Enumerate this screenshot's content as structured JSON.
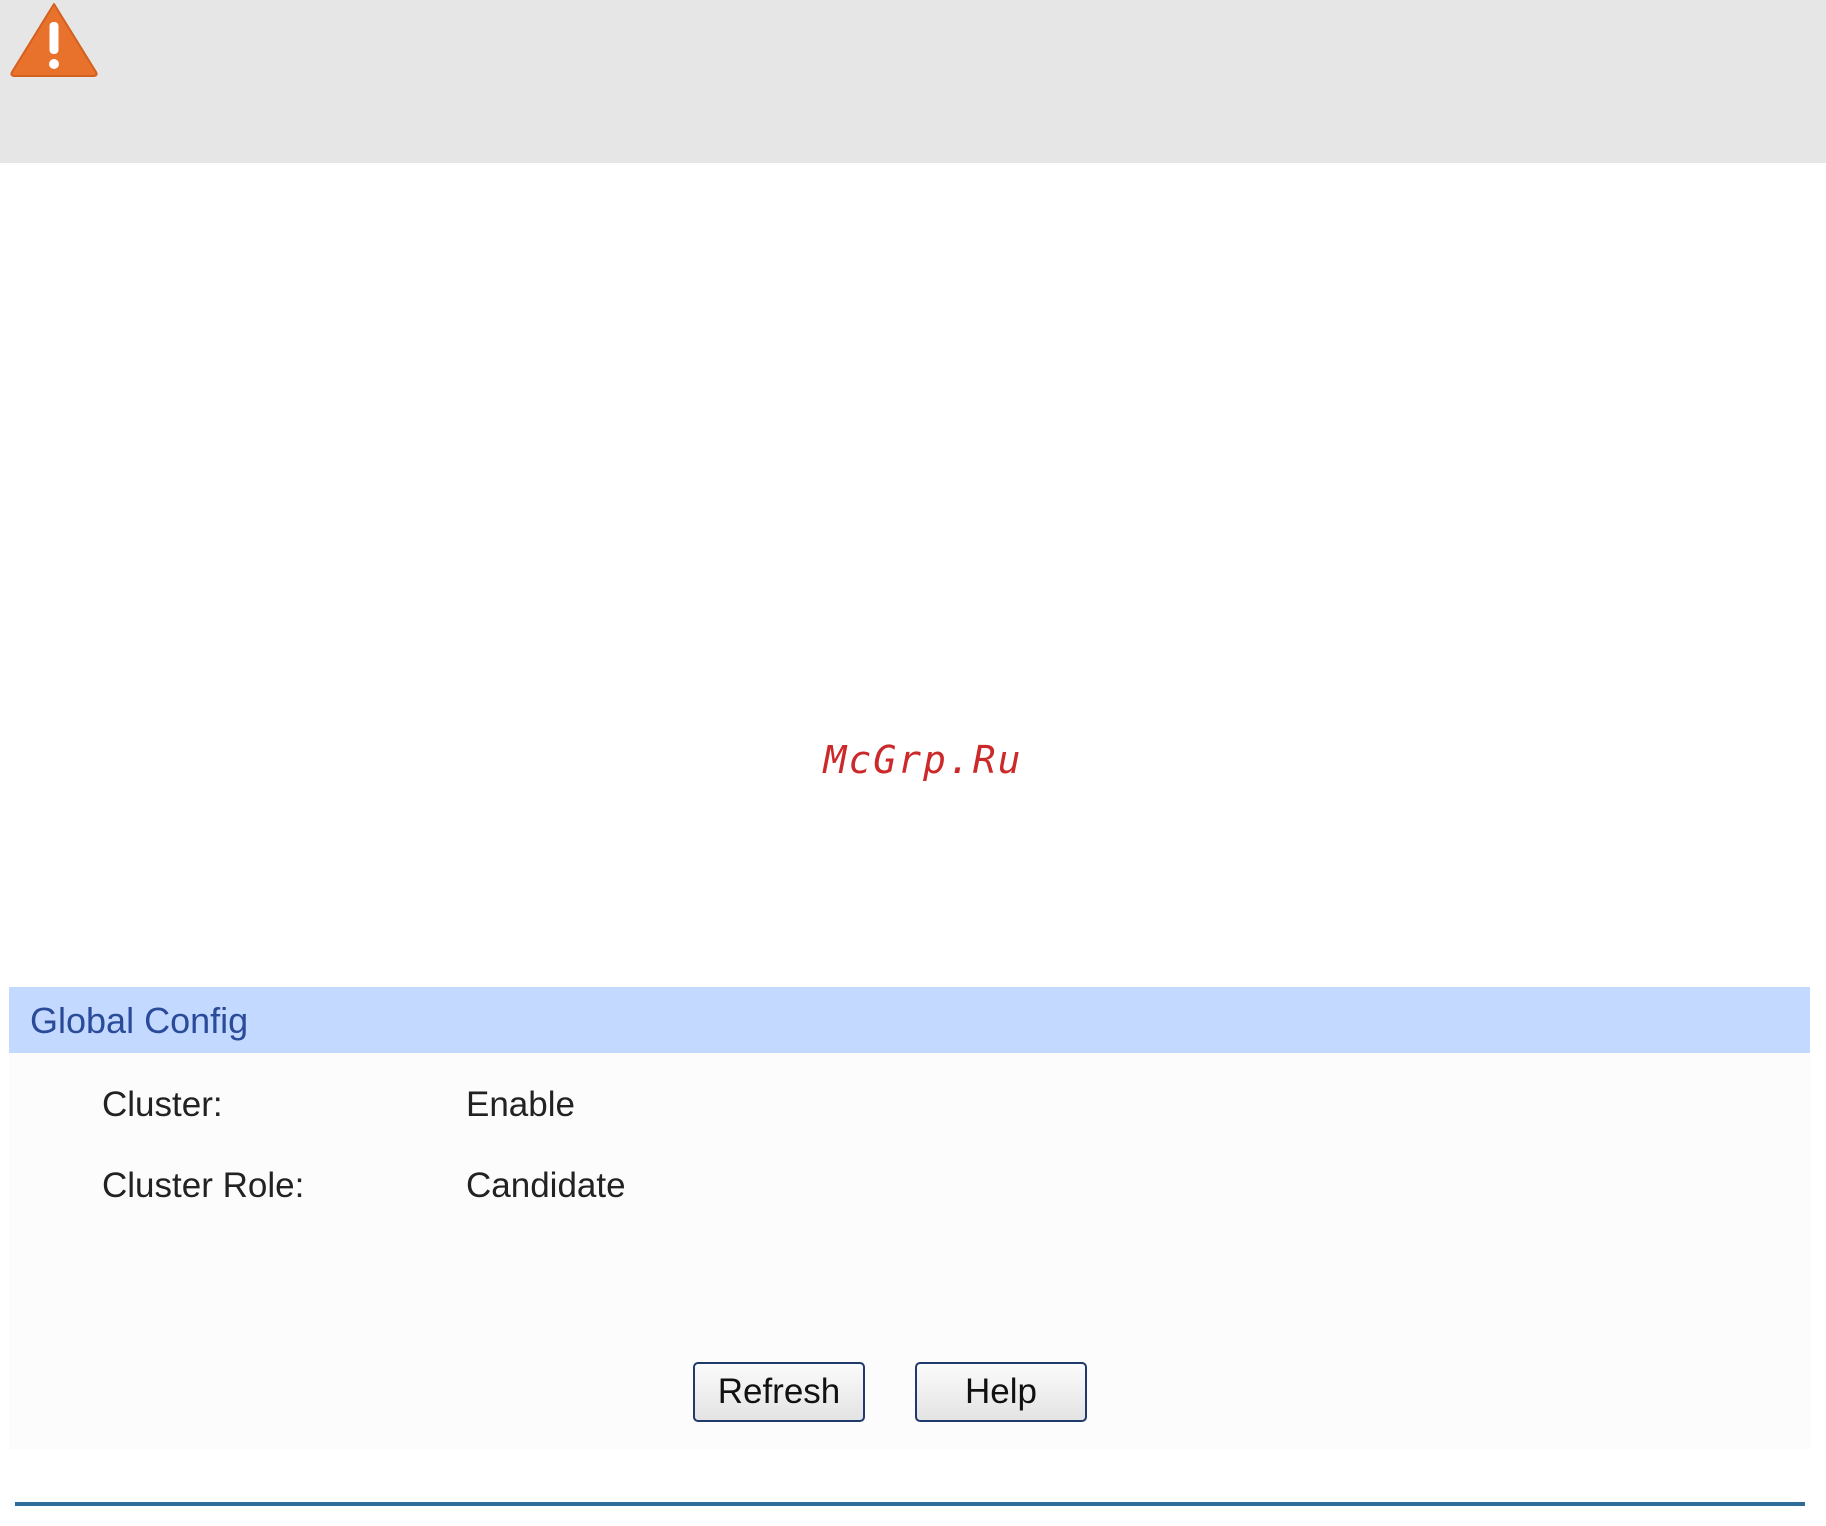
{
  "watermark": "McGrp.Ru",
  "panel": {
    "title": "Global Config",
    "fields": [
      {
        "label": "Cluster:",
        "value": "Enable"
      },
      {
        "label": "Cluster Role:",
        "value": "Candidate"
      }
    ]
  },
  "buttons": {
    "refresh": "Refresh",
    "help": "Help"
  },
  "colors": {
    "banner_bg": "#e6e6e6",
    "warning_icon": "#e8712b",
    "panel_header_bg": "#c4d9ff",
    "panel_title": "#2a4a9a",
    "watermark": "#cc2a2a",
    "bottom_rule": "#2e6d99"
  },
  "icons": {
    "notice": "warning-icon"
  }
}
